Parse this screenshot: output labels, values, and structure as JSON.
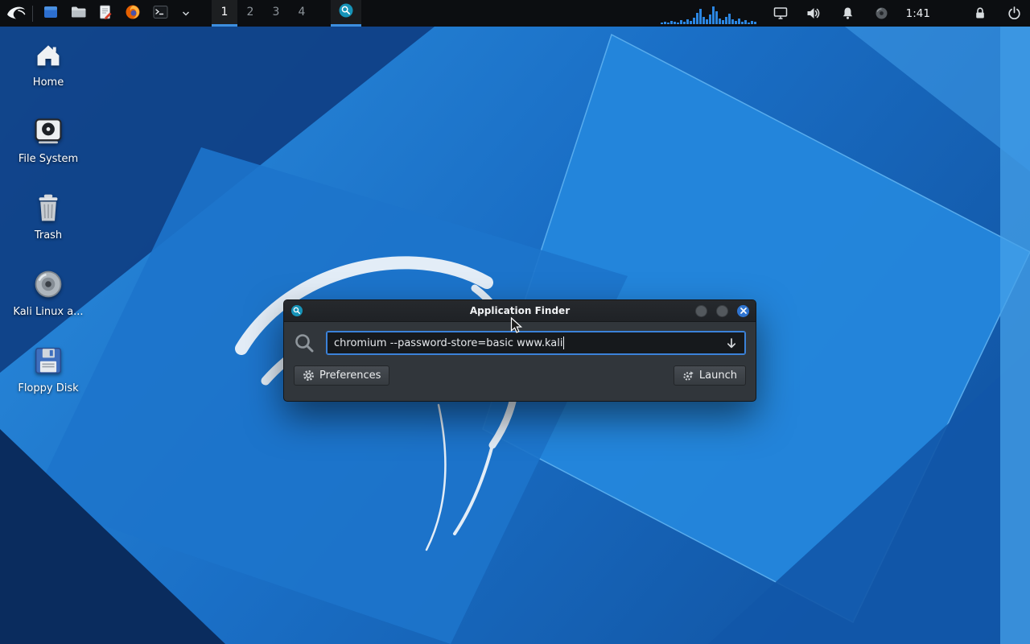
{
  "panel": {
    "workspaces": [
      "1",
      "2",
      "3",
      "4"
    ],
    "active_workspace": "1",
    "clock": "1:41",
    "graph_bars": [
      2,
      3,
      2,
      4,
      3,
      2,
      5,
      3,
      6,
      4,
      8,
      14,
      19,
      9,
      6,
      12,
      22,
      16,
      7,
      5,
      9,
      13,
      6,
      4,
      7,
      3,
      5,
      2,
      4,
      3
    ],
    "icons": {
      "menu": "kali-logo-icon",
      "launchers": [
        "window-icon",
        "file-manager-icon",
        "text-editor-icon",
        "firefox-icon",
        "terminal-icon"
      ],
      "tray": [
        "network-graph",
        "display-icon",
        "volume-icon",
        "notifications-icon",
        "indicator-icon",
        "lock-icon",
        "logout-icon"
      ]
    }
  },
  "desktop": {
    "icons": [
      {
        "label": "Home",
        "icon": "home-icon"
      },
      {
        "label": "File System",
        "icon": "drive-icon"
      },
      {
        "label": "Trash",
        "icon": "trash-icon"
      },
      {
        "label": "Kali Linux a...",
        "icon": "disc-icon"
      },
      {
        "label": "Floppy Disk",
        "icon": "floppy-icon"
      }
    ]
  },
  "dialog": {
    "title": "Application Finder",
    "search_value": "chromium --password-store=basic www.kali",
    "preferences_label": "Preferences",
    "launch_label": "Launch"
  },
  "colors": {
    "accent": "#3d8fe0",
    "close_button": "#2f74d0",
    "input_focus_border": "#3b82d9",
    "wallpaper_base": "#1a6fc6"
  }
}
